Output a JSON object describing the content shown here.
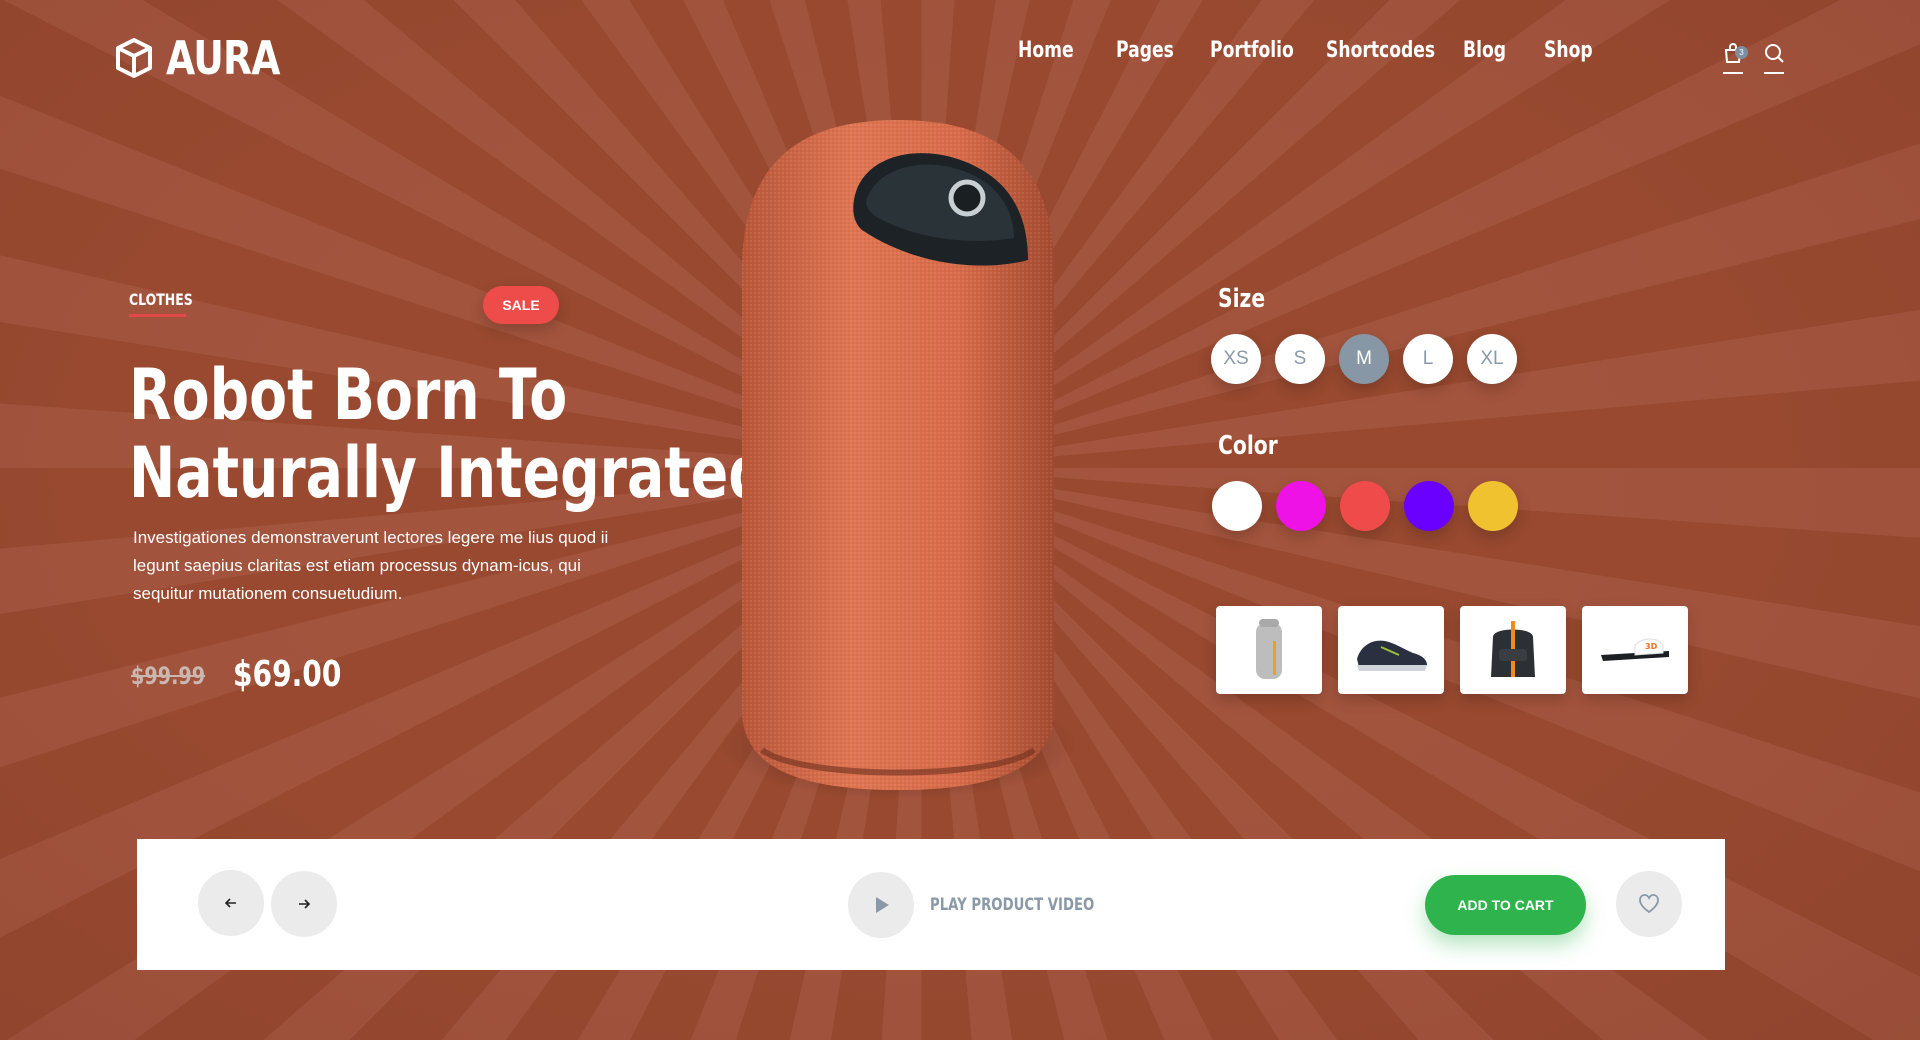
{
  "brand": {
    "name": "AURA"
  },
  "nav": {
    "items": [
      "Home",
      "Pages",
      "Portfolio",
      "Shortcodes",
      "Blog",
      "Shop"
    ]
  },
  "header": {
    "cart_count": "3"
  },
  "hero": {
    "category": "CLOTHES",
    "badge": "SALE",
    "title_line1": "Robot Born To",
    "title_line2": "Naturally Integrated",
    "description": "Investigationes demonstraverunt lectores legere me lius quod ii legunt saepius claritas est etiam processus dynam-icus, qui sequitur mutationem consuetudium.",
    "price_old": "$99.99",
    "price_new": "$69.00"
  },
  "options": {
    "size_label": "Size",
    "sizes": [
      "XS",
      "S",
      "M",
      "L",
      "XL"
    ],
    "selected_size": "M",
    "color_label": "Color",
    "colors": [
      "#ffffff",
      "#ee12e6",
      "#ef4b4b",
      "#6a00ff",
      "#f0c230"
    ]
  },
  "thumbnails": [
    "backpack-gray",
    "sneaker-dark",
    "backpack-black",
    "slide-sandal"
  ],
  "actions": {
    "video_label": "PLAY PRODUCT VIDEO",
    "add_to_cart": "ADD TO CART"
  },
  "colors": {
    "background": "#9a4a34",
    "sale": "#ee4b4b",
    "cart_button": "#2fb44d",
    "muted": "#8a99a8"
  }
}
